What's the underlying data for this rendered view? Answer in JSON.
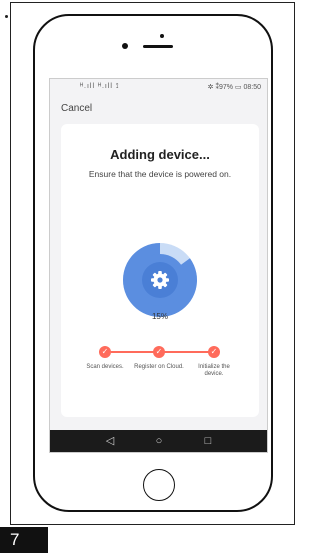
{
  "status_bar": {
    "signal_text": "ᴴ.ıll ᴴ.ıll ⟟",
    "right_text": "✲ ⁑97% ▭ 08:50"
  },
  "header": {
    "cancel_label": "Cancel"
  },
  "card": {
    "title": "Adding device...",
    "subtitle": "Ensure that the device is powered on.",
    "progress": {
      "percent_label": "15%",
      "value": 0.15
    },
    "steps": [
      {
        "label": "Scan devices."
      },
      {
        "label": "Register on Cloud."
      },
      {
        "label": "Initialize the device."
      }
    ]
  },
  "nav": {
    "back_icon": "back-triangle-icon",
    "home_icon": "home-circle-icon",
    "recent_icon": "recent-square-icon"
  },
  "page_number": "7",
  "colors": {
    "accent": "#ff6b5b",
    "ring": "#5b8ee0",
    "ring_light": "#c9dcf6"
  }
}
